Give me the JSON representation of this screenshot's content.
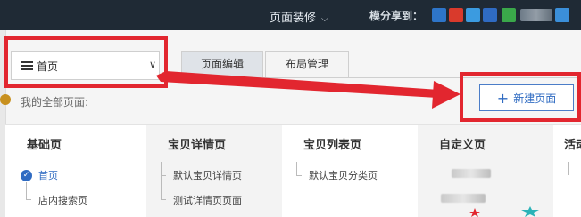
{
  "topbar": {
    "menu_label": "页面装修",
    "share_label": "模分享到："
  },
  "home_select": {
    "label": "首页"
  },
  "tabs": [
    {
      "label": "页面编辑"
    },
    {
      "label": "布局管理"
    }
  ],
  "my_pages_label": "我的全部页面:",
  "new_page_button": "新建页面",
  "columns": [
    {
      "title": "基础页",
      "items": [
        "首页",
        "店内搜索页"
      ]
    },
    {
      "title": "宝贝详情页",
      "items": [
        "默认宝贝详情页",
        "测试详情页页面"
      ]
    },
    {
      "title": "宝贝列表页",
      "items": [
        "默认宝贝分类页"
      ]
    },
    {
      "title": "自定义页",
      "items": []
    },
    {
      "title": "活动",
      "items": []
    }
  ],
  "colors": {
    "topbar_bg": "#1f2a35",
    "accent_blue": "#2f6bc2",
    "annotation_red": "#e2262f"
  }
}
